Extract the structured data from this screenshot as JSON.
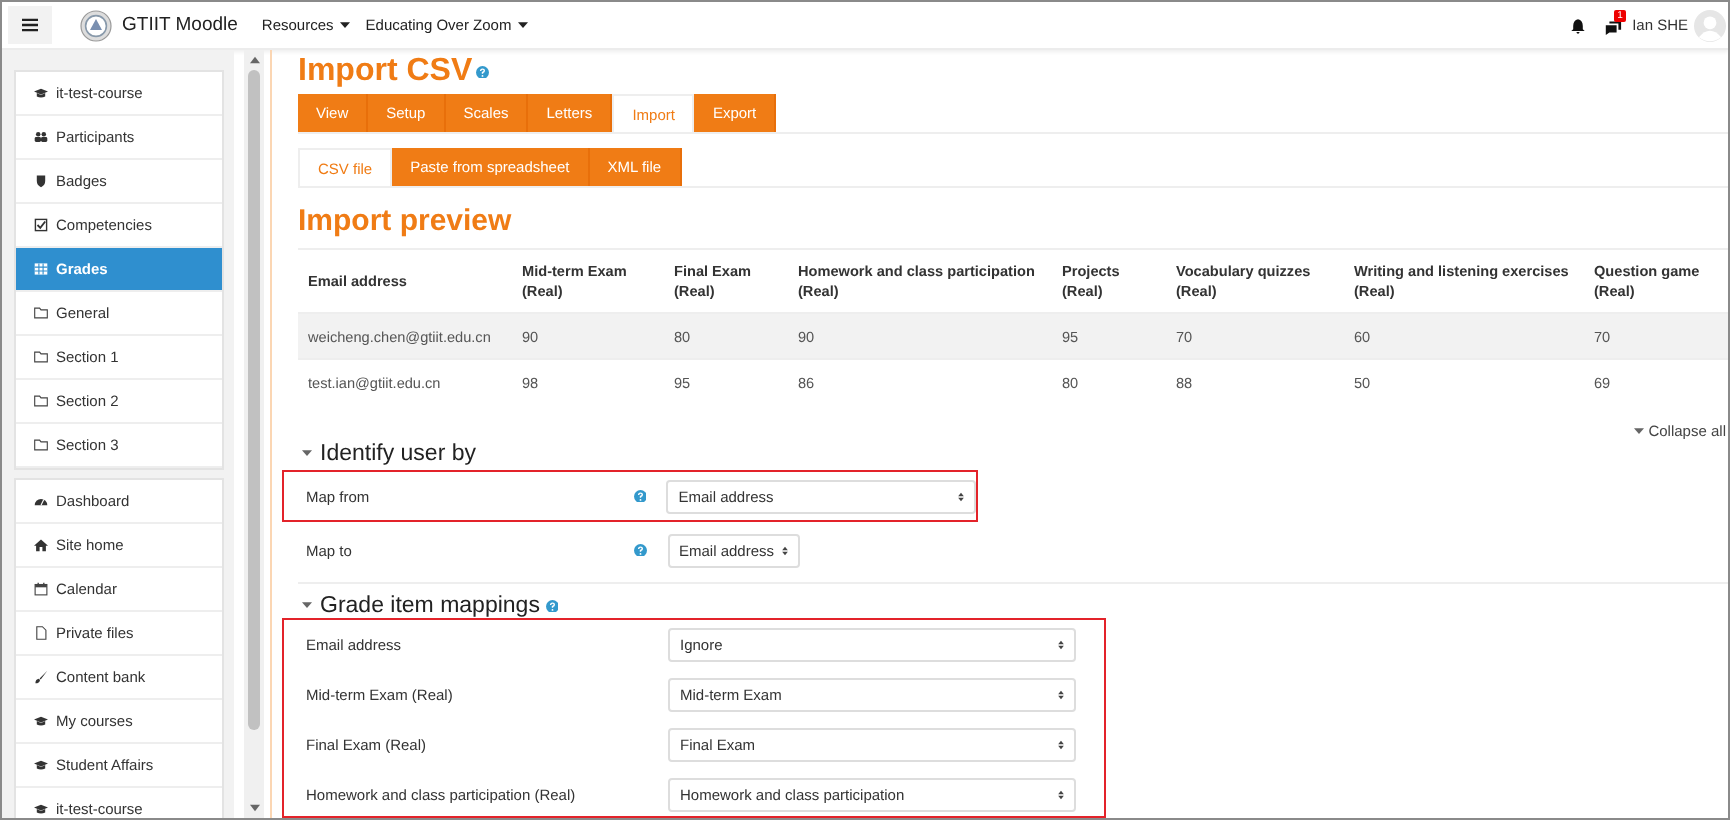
{
  "navbar": {
    "site_name": "GTIIT Moodle",
    "menus": [
      {
        "label": "Resources"
      },
      {
        "label": "Educating Over Zoom"
      }
    ],
    "message_badge": "1",
    "user_name": "Ian SHE"
  },
  "sidebar": {
    "groups": [
      [
        {
          "label": "it-test-course",
          "kind": "course",
          "selected": false
        },
        {
          "label": "Participants",
          "kind": "people",
          "selected": false
        },
        {
          "label": "Badges",
          "kind": "badge",
          "selected": false
        },
        {
          "label": "Competencies",
          "kind": "check",
          "selected": false
        },
        {
          "label": "Grades",
          "kind": "grid",
          "selected": true
        },
        {
          "label": "General",
          "kind": "folder",
          "selected": false
        },
        {
          "label": "Section 1",
          "kind": "folder",
          "selected": false
        },
        {
          "label": "Section 2",
          "kind": "folder",
          "selected": false
        },
        {
          "label": "Section 3",
          "kind": "folder",
          "selected": false
        }
      ],
      [
        {
          "label": "Dashboard",
          "kind": "gauge",
          "selected": false
        },
        {
          "label": "Site home",
          "kind": "home",
          "selected": false
        },
        {
          "label": "Calendar",
          "kind": "calendar",
          "selected": false
        },
        {
          "label": "Private files",
          "kind": "file",
          "selected": false
        },
        {
          "label": "Content bank",
          "kind": "brush",
          "selected": false
        },
        {
          "label": "My courses",
          "kind": "course",
          "selected": false
        },
        {
          "label": "Student Affairs",
          "kind": "course",
          "selected": false
        },
        {
          "label": "it-test-course",
          "kind": "course",
          "selected": false
        }
      ]
    ]
  },
  "page_title": "Import CSV",
  "tabs": [
    {
      "label": "View",
      "selected": false
    },
    {
      "label": "Setup",
      "selected": false
    },
    {
      "label": "Scales",
      "selected": false
    },
    {
      "label": "Letters",
      "selected": false
    },
    {
      "label": "Import",
      "selected": true
    },
    {
      "label": "Export",
      "selected": false
    }
  ],
  "subtabs": [
    {
      "label": "CSV file",
      "selected": true
    },
    {
      "label": "Paste from spreadsheet",
      "selected": false
    },
    {
      "label": "XML file",
      "selected": false
    }
  ],
  "preview": {
    "title": "Import preview",
    "columns": [
      {
        "label": "Email address"
      },
      {
        "label": "Mid-term Exam",
        "unit": "(Real)"
      },
      {
        "label": "Final Exam",
        "unit": "(Real)"
      },
      {
        "label": "Homework and class participation",
        "unit": "(Real)"
      },
      {
        "label": "Projects",
        "unit": "(Real)"
      },
      {
        "label": "Vocabulary quizzes",
        "unit": "(Real)"
      },
      {
        "label": "Writing and listening exercises",
        "unit": "(Real)"
      },
      {
        "label": "Question game",
        "unit": "(Real)"
      }
    ],
    "rows": [
      [
        "weicheng.chen@gtiit.edu.cn",
        "90",
        "80",
        "90",
        "95",
        "70",
        "60",
        "70"
      ],
      [
        "test.ian@gtiit.edu.cn",
        "98",
        "95",
        "86",
        "80",
        "88",
        "50",
        "69"
      ]
    ]
  },
  "collapse_all": "Collapse all",
  "identify": {
    "title": "Identify user by",
    "rows": [
      {
        "label": "Map from",
        "value": "Email address",
        "wide": true,
        "highlighted": true
      },
      {
        "label": "Map to",
        "value": "Email address",
        "wide": false,
        "highlighted": false
      }
    ]
  },
  "mappings": {
    "title": "Grade item mappings",
    "highlighted": true,
    "rows": [
      {
        "label": "Email address",
        "value": "Ignore"
      },
      {
        "label": "Mid-term Exam (Real)",
        "value": "Mid-term Exam"
      },
      {
        "label": "Final Exam (Real)",
        "value": "Final Exam"
      },
      {
        "label": "Homework and class participation (Real)",
        "value": "Homework and class participation"
      }
    ]
  }
}
